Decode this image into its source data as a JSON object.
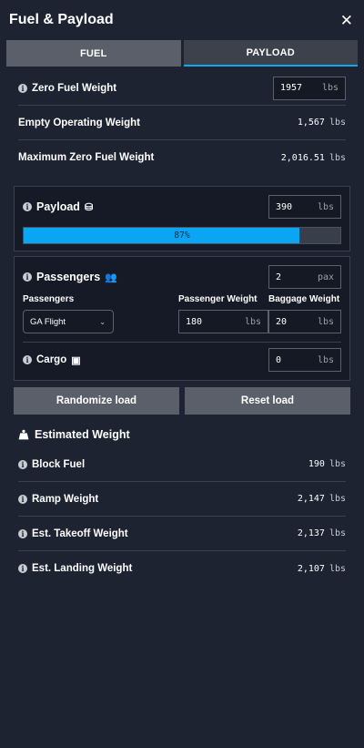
{
  "header": {
    "title": "Fuel & Payload",
    "close_glyph": "✕"
  },
  "tabs": [
    {
      "label": "FUEL",
      "active": false
    },
    {
      "label": "PAYLOAD",
      "active": true
    }
  ],
  "zero_fuel_weight": {
    "label": "Zero Fuel Weight",
    "value": "1957",
    "unit": "lbs"
  },
  "empty_operating_weight": {
    "label": "Empty Operating Weight",
    "value": "1,567",
    "unit": "lbs"
  },
  "max_zero_fuel_weight": {
    "label": "Maximum Zero Fuel Weight",
    "value": "2,016.51",
    "unit": "lbs"
  },
  "payload": {
    "label": "Payload",
    "value": "390",
    "unit": "lbs",
    "progress_percent": 87,
    "progress_text": "87%"
  },
  "passengers": {
    "label": "Passengers",
    "count": "2",
    "count_unit": "pax",
    "passengers_col_label": "Passengers",
    "passenger_weight_label": "Passenger Weight",
    "baggage_weight_label": "Baggage Weight",
    "profile_selected": "GA Flight",
    "passenger_weight": "180",
    "baggage_weight": "20",
    "weight_unit": "lbs"
  },
  "cargo": {
    "label": "Cargo",
    "value": "0",
    "unit": "lbs"
  },
  "buttons": {
    "randomize": "Randomize load",
    "reset": "Reset load"
  },
  "estimated": {
    "title": "Estimated Weight",
    "rows": [
      {
        "label": "Block Fuel",
        "value": "190",
        "unit": "lbs"
      },
      {
        "label": "Ramp Weight",
        "value": "2,147",
        "unit": "lbs"
      },
      {
        "label": "Est. Takeoff Weight",
        "value": "2,137",
        "unit": "lbs"
      },
      {
        "label": "Est. Landing Weight",
        "value": "2,107",
        "unit": "lbs"
      }
    ]
  },
  "colors": {
    "accent": "#1aa4e8",
    "bar_fill": "#0aa6f3",
    "background": "#1d2331",
    "card": "#151a26"
  }
}
